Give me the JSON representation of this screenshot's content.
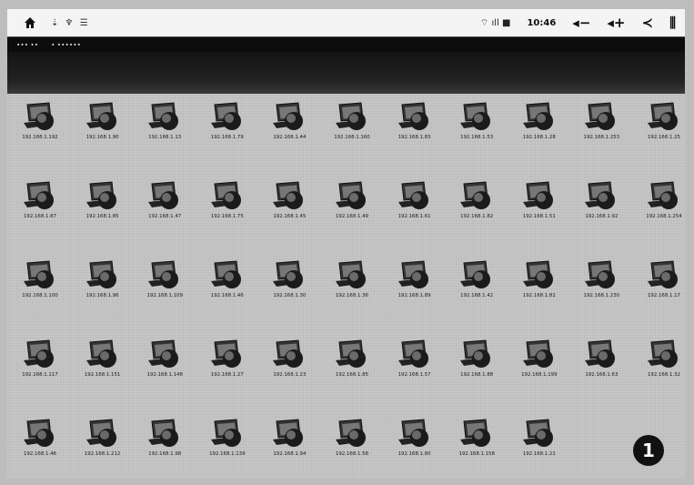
{
  "status_bar": {
    "notification_icons": "⇣ ♆ ☰",
    "signal_text": "⌔ ıll ■",
    "time": "10:46",
    "volume_down": "◂−",
    "volume_up": "◂+",
    "back": "≺",
    "menu": "⫼"
  },
  "title_bar": {
    "left_text": "∙∙∙ ∙∙",
    "app_title": "∙ ∙∙∙∙∙∙"
  },
  "devices": [
    "192.168.1.192",
    "192.168.1.90",
    "192.168.1.13",
    "192.168.1.79",
    "192.168.1.44",
    "192.168.1.160",
    "192.168.1.83",
    "192.168.1.53",
    "192.168.1.28",
    "192.168.1.253",
    "192.168.1.25",
    "192.168.1.87",
    "192.168.1.85",
    "192.168.1.47",
    "192.168.1.75",
    "192.168.1.45",
    "192.168.1.49",
    "192.168.1.61",
    "192.168.1.82",
    "192.168.1.51",
    "192.168.1.92",
    "192.168.1.254",
    "192.168.1.100",
    "192.168.1.96",
    "192.168.1.109",
    "192.168.1.46",
    "192.168.1.30",
    "192.168.1.36",
    "192.168.1.89",
    "192.168.1.42",
    "192.168.1.82",
    "192.168.1.230",
    "192.168.1.17",
    "192.168.1.117",
    "192.168.1.151",
    "192.168.1.148",
    "192.168.1.27",
    "192.168.1.23",
    "192.168.1.85",
    "192.168.1.57",
    "192.168.1.88",
    "192.168.1.199",
    "192.168.1.63",
    "192.168.1.32",
    "192.168.1.46",
    "192.168.1.212",
    "192.168.1.98",
    "192.168.1.139",
    "192.168.1.94",
    "192.168.1.58",
    "192.168.1.80",
    "192.168.1.158",
    "192.168.1.22"
  ],
  "page_badge": "1",
  "colors": {
    "background": "#c6c6c6",
    "title_bar": "#0c0c0c",
    "status_bar": "#f4f4f4"
  }
}
